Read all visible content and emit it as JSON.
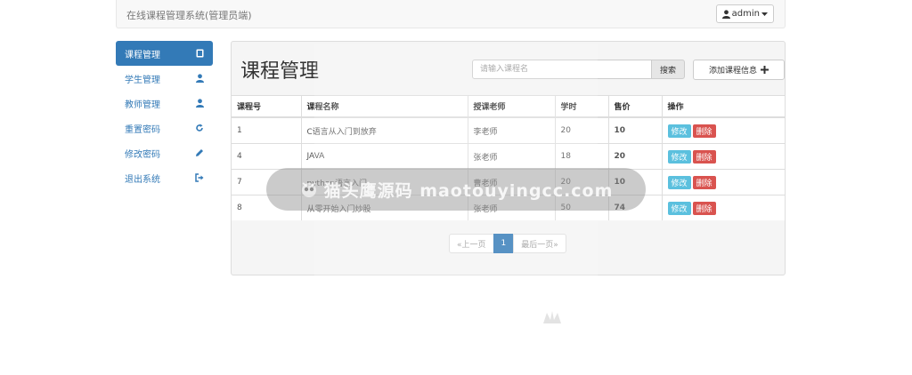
{
  "navbar": {
    "brand": "在线课程管理系统(管理员端)",
    "user_label": "admin"
  },
  "sidebar": {
    "items": [
      {
        "label": "课程管理",
        "icon": "book-icon",
        "active": true
      },
      {
        "label": "学生管理",
        "icon": "user-icon"
      },
      {
        "label": "教师管理",
        "icon": "user-icon"
      },
      {
        "label": "重置密码",
        "icon": "refresh-icon"
      },
      {
        "label": "修改密码",
        "icon": "pencil-icon"
      },
      {
        "label": "退出系统",
        "icon": "logout-icon"
      }
    ]
  },
  "main": {
    "title": "课程管理",
    "search_placeholder": "请输入课程名",
    "search_label": "搜索",
    "add_label": "添加课程信息",
    "columns": [
      "课程号",
      "课程名称",
      "授课老师",
      "学时",
      "售价",
      "操作"
    ],
    "rows": [
      {
        "id": "1",
        "name": "C语言从入门到放弃",
        "teacher": "李老师",
        "hours": "20",
        "price": "10"
      },
      {
        "id": "4",
        "name": "JAVA",
        "teacher": "张老师",
        "hours": "18",
        "price": "20"
      },
      {
        "id": "7",
        "name": "python语言入门",
        "teacher": "曹老师",
        "hours": "20",
        "price": "10"
      },
      {
        "id": "8",
        "name": "从零开始入门炒股",
        "teacher": "张老师",
        "hours": "50",
        "price": "74"
      }
    ],
    "edit_label": "修改",
    "delete_label": "删除",
    "pagination": {
      "prev": "«上一页",
      "current": "1",
      "next": "最后一页»"
    }
  },
  "watermark": {
    "text": "猫头鹰源码 maotouyingcc.com"
  },
  "colors": {
    "primary": "#337ab7",
    "info": "#5bc0de",
    "danger": "#d9534f"
  }
}
